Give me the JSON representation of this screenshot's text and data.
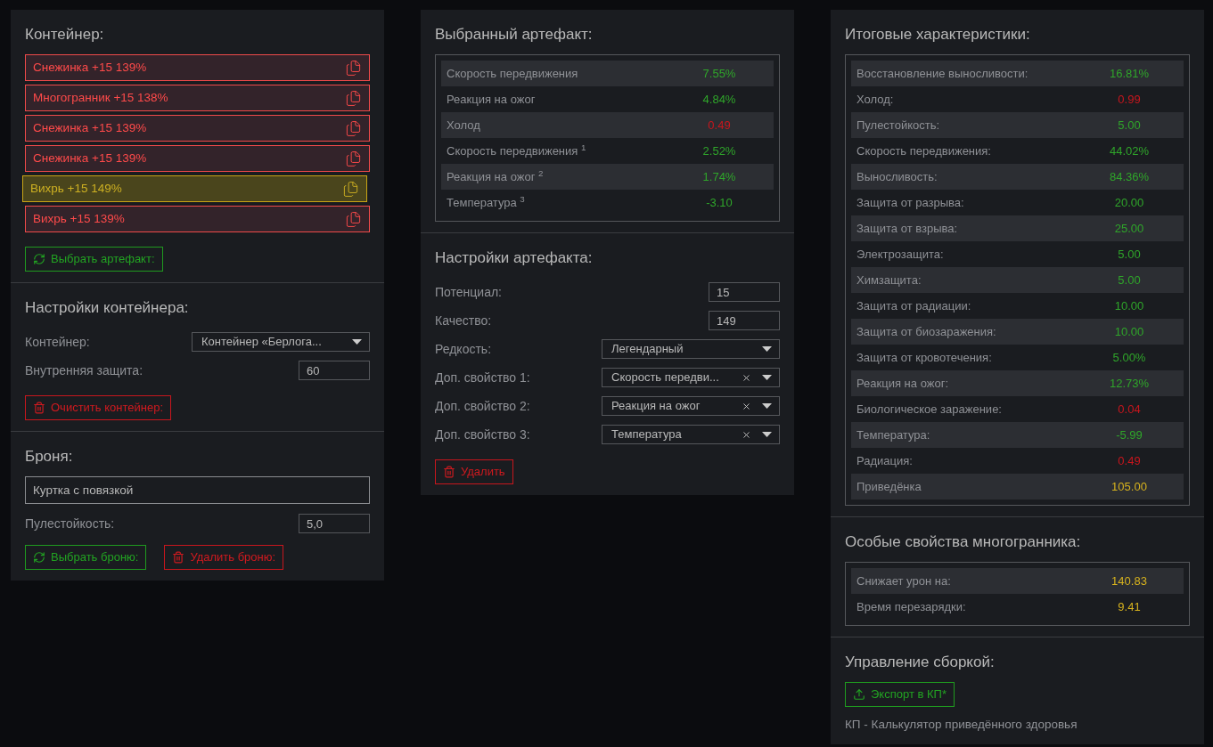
{
  "container": {
    "title": "Контейнер:",
    "items": [
      {
        "label": "Снежинка +15 139%",
        "selected": false
      },
      {
        "label": "Многогранник +15 138%",
        "selected": false
      },
      {
        "label": "Снежинка +15 139%",
        "selected": false
      },
      {
        "label": "Снежинка +15 139%",
        "selected": false
      },
      {
        "label": "Вихрь +15 149%",
        "selected": true
      },
      {
        "label": "Вихрь +15 139%",
        "selected": false
      }
    ],
    "choose_button": "Выбрать артефакт:"
  },
  "container_settings": {
    "title": "Настройки контейнера:",
    "fields": [
      {
        "kind": "select",
        "label": "Контейнер:",
        "value": "Контейнер «Берлога...",
        "clearable": false
      },
      {
        "kind": "input",
        "label": "Внутренняя защита:",
        "value": "60"
      }
    ],
    "clear_button": "Очистить контейнер:"
  },
  "armor": {
    "title": "Броня:",
    "name_value": "Куртка с повязкой",
    "fields": [
      {
        "kind": "input",
        "label": "Пулестойкость:",
        "value": "5,0"
      }
    ],
    "choose_button": "Выбрать броню:",
    "delete_button": "Удалить броню:"
  },
  "selected_artifact": {
    "title": "Выбранный артефакт:",
    "stats": [
      {
        "label": "Скорость передвижения",
        "value": "7.55%",
        "kind": "positive"
      },
      {
        "label": "Реакция на ожог",
        "value": "4.84%",
        "kind": "positive"
      },
      {
        "label": "Холод",
        "value": "0.49",
        "kind": "negative"
      },
      {
        "label": "Скорость передвижения $^{1}$",
        "value": "2.52%",
        "kind": "positive"
      },
      {
        "label": "Реакция на ожог $^{2}$",
        "value": "1.74%",
        "kind": "positive"
      },
      {
        "label": "Температура $^{3}$",
        "value": "-3.10",
        "kind": "positive"
      }
    ]
  },
  "artifact_settings": {
    "title": "Настройки артефакта:",
    "fields": [
      {
        "kind": "input",
        "label": "Потенциал:",
        "value": "15"
      },
      {
        "kind": "input",
        "label": "Качество:",
        "value": "149"
      },
      {
        "kind": "select",
        "label": "Редкость:",
        "value": "Легендарный",
        "clearable": false
      },
      {
        "kind": "select",
        "label": "Доп. свойство 1:",
        "value": "Скорость передви...",
        "clearable": true
      },
      {
        "kind": "select",
        "label": "Доп. свойство 2:",
        "value": "Реакция на ожог",
        "clearable": true
      },
      {
        "kind": "select",
        "label": "Доп. свойство 3:",
        "value": "Температура",
        "clearable": true
      }
    ],
    "delete_button": "Удалить"
  },
  "total_stats": {
    "title": "Итоговые характеристики:",
    "stats": [
      {
        "label": "Восстановление выносливости:",
        "value": "16.81%",
        "kind": "positive"
      },
      {
        "label": "Холод:",
        "value": "0.99",
        "kind": "negative"
      },
      {
        "label": "Пулестойкость:",
        "value": "5.00",
        "kind": "positive"
      },
      {
        "label": "Скорость передвижения:",
        "value": "44.02%",
        "kind": "positive"
      },
      {
        "label": "Выносливость:",
        "value": "84.36%",
        "kind": "positive"
      },
      {
        "label": "Защита от разрыва:",
        "value": "20.00",
        "kind": "positive"
      },
      {
        "label": "Защита от взрыва:",
        "value": "25.00",
        "kind": "positive"
      },
      {
        "label": "Электрозащита:",
        "value": "5.00",
        "kind": "positive"
      },
      {
        "label": "Химзащита:",
        "value": "5.00",
        "kind": "positive"
      },
      {
        "label": "Защита от радиации:",
        "value": "10.00",
        "kind": "positive"
      },
      {
        "label": "Защита от биозаражения:",
        "value": "10.00",
        "kind": "positive"
      },
      {
        "label": "Защита от кровотечения:",
        "value": "5.00%",
        "kind": "positive"
      },
      {
        "label": "Реакция на ожог:",
        "value": "12.73%",
        "kind": "positive"
      },
      {
        "label": "Биологическое заражение:",
        "value": "0.04",
        "kind": "negative"
      },
      {
        "label": "Температура:",
        "value": "-5.99",
        "kind": "positive"
      },
      {
        "label": "Радиация:",
        "value": "0.49",
        "kind": "negative"
      },
      {
        "label": "Приведёнка",
        "value": "105.00",
        "kind": "neutral"
      }
    ]
  },
  "polyhedron": {
    "title": "Особые свойства многогранника:",
    "stats": [
      {
        "label": "Снижает урон на:",
        "value": "140.83",
        "kind": "neutral"
      },
      {
        "label": "Время перезарядки:",
        "value": "9.41",
        "kind": "neutral"
      }
    ]
  },
  "build": {
    "title": "Управление сборкой:",
    "export_button": "Экспорт в КП*",
    "note": "КП - Калькулятор приведённого здоровья"
  }
}
